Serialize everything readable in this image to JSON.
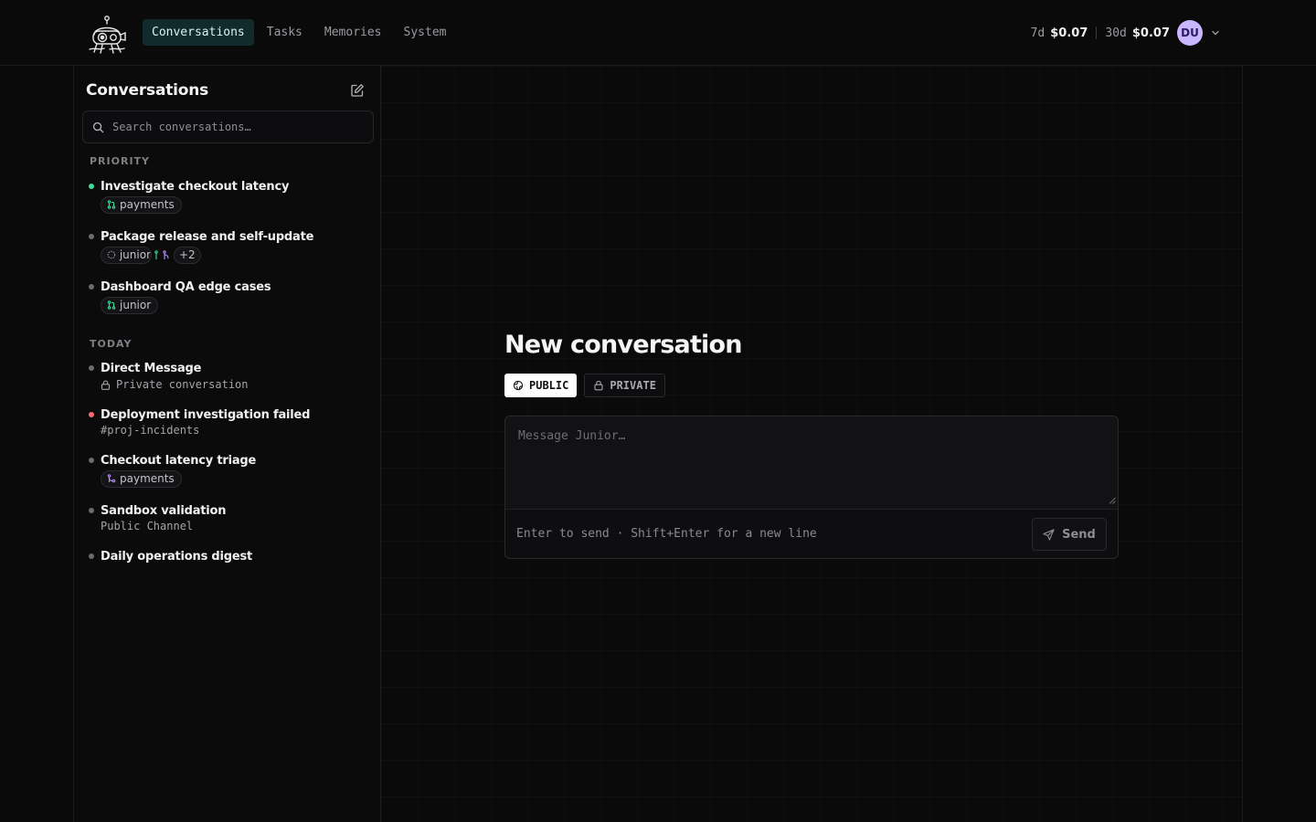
{
  "header": {
    "logo_icon": "robot-mascot-icon",
    "nav": [
      {
        "label": "Conversations",
        "active": true
      },
      {
        "label": "Tasks",
        "active": false
      },
      {
        "label": "Memories",
        "active": false
      },
      {
        "label": "System",
        "active": false
      }
    ],
    "usage": [
      {
        "period": "7d",
        "amount": "$0.07"
      },
      {
        "period": "30d",
        "amount": "$0.07"
      }
    ],
    "avatar_initials": "DU",
    "avatar_color": "#c9b6ff"
  },
  "sidebar": {
    "title": "Conversations",
    "new_icon": "edit-square-icon",
    "search_placeholder": "Search conversations…",
    "sections": [
      {
        "label": "PRIORITY",
        "items": [
          {
            "title": "Investigate checkout latency",
            "status": "green",
            "chips": [
              {
                "icon": "git-pull-request-icon",
                "label": "payments"
              }
            ]
          },
          {
            "title": "Package release and self-update",
            "status": "gray",
            "chips": [
              {
                "icon": "loading-circle-icon",
                "label": "junior"
              },
              {
                "icon": "git-branch-icon",
                "label": ""
              },
              {
                "icon": "git-merge-icon",
                "label": ""
              },
              {
                "label": "+2"
              }
            ]
          },
          {
            "title": "Dashboard QA edge cases",
            "status": "gray",
            "chips": [
              {
                "icon": "git-pull-request-icon",
                "label": "junior"
              }
            ]
          }
        ]
      },
      {
        "label": "TODAY",
        "items": [
          {
            "title": "Direct Message",
            "status": "gray",
            "subtitle": "Private conversation",
            "subtitle_icon": "lock-icon"
          },
          {
            "title": "Deployment investigation failed",
            "status": "red",
            "subtitle": "#proj-incidents"
          },
          {
            "title": "Checkout latency triage",
            "status": "gray",
            "chips": [
              {
                "icon": "git-merge-icon",
                "label": "payments"
              }
            ]
          },
          {
            "title": "Sandbox validation",
            "status": "gray",
            "subtitle": "Public Channel"
          },
          {
            "title": "Daily operations digest",
            "status": "gray"
          }
        ]
      }
    ]
  },
  "main": {
    "title": "New conversation",
    "visibility": [
      {
        "label": "PUBLIC",
        "icon": "globe-icon",
        "active": true
      },
      {
        "label": "PRIVATE",
        "icon": "lock-icon",
        "active": false
      }
    ],
    "composer": {
      "placeholder": "Message Junior…",
      "hint": "Enter to send · Shift+Enter for a new line",
      "send_label": "Send"
    }
  },
  "colors": {
    "accent_nav_bg": "#112a2b",
    "status_green": "#3ddc97",
    "status_red": "#ff6b6b",
    "purple_icon": "#b98cff"
  }
}
